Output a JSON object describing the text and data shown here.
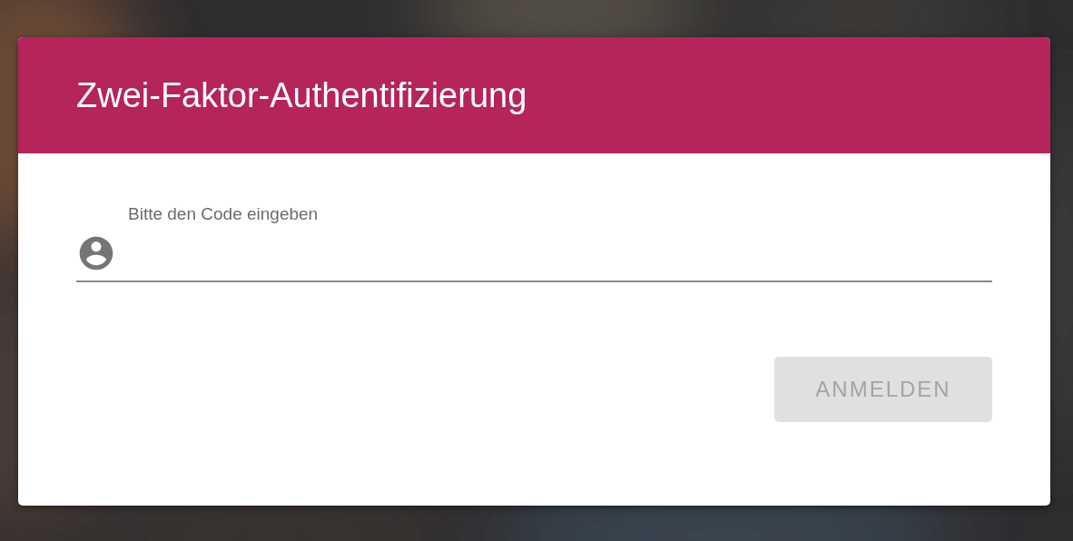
{
  "dialog": {
    "title": "Zwei-Faktor-Authentifizierung",
    "field": {
      "label": "Bitte den Code eingeben"
    },
    "button": {
      "label": "ANMELDEN",
      "disabled": true
    }
  }
}
